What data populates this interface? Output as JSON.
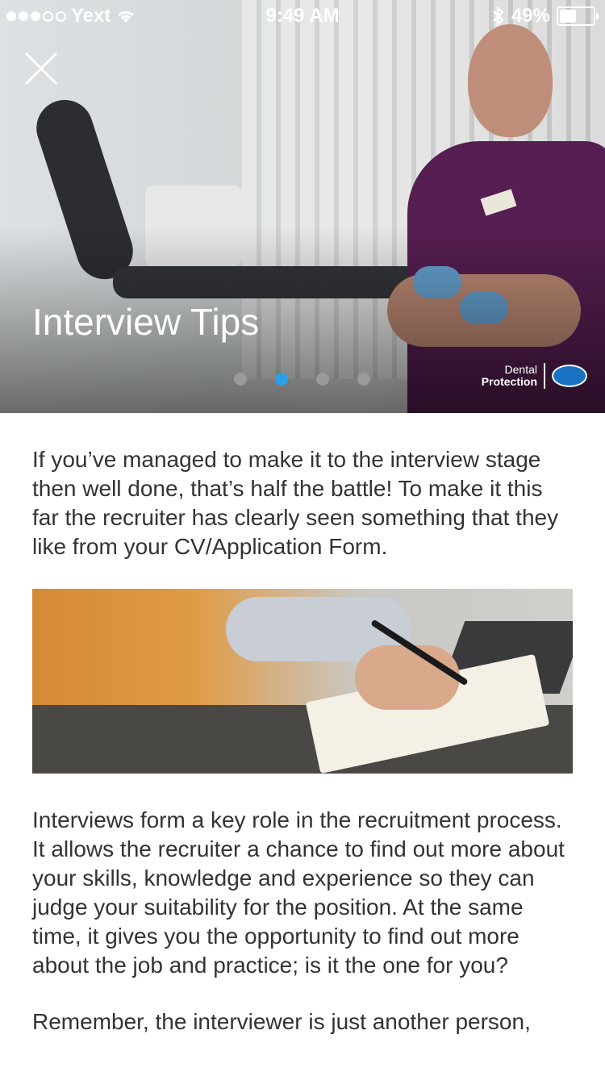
{
  "status_bar": {
    "carrier": "Yext",
    "time": "9:49 AM",
    "battery_percent": "49%",
    "signal_bars_filled": 3,
    "signal_bars_total": 5,
    "battery_level": 0.49
  },
  "header": {
    "title": "Interview Tips",
    "close_icon": "close-icon"
  },
  "pager": {
    "count": 4,
    "active_index": 1,
    "active_color": "#2aa1e6"
  },
  "brand": {
    "line1": "Dental",
    "line2": "Protection"
  },
  "content": {
    "intro": "If you’ve managed to make it to the interview stage then well done, that’s half the battle! To make it this far the recruiter has clearly seen something that they like from your CV/Application Form.",
    "paragraph2": "Interviews form a key role in the recruitment process. It allows the recruiter a chance to find out more about your skills, knowledge and experience so they can judge your suitability for the position. At the same time, it gives you the opportunity to find out more about the job and practice; is it the one for you?",
    "paragraph3": "Remember, the interviewer is just another person,"
  }
}
